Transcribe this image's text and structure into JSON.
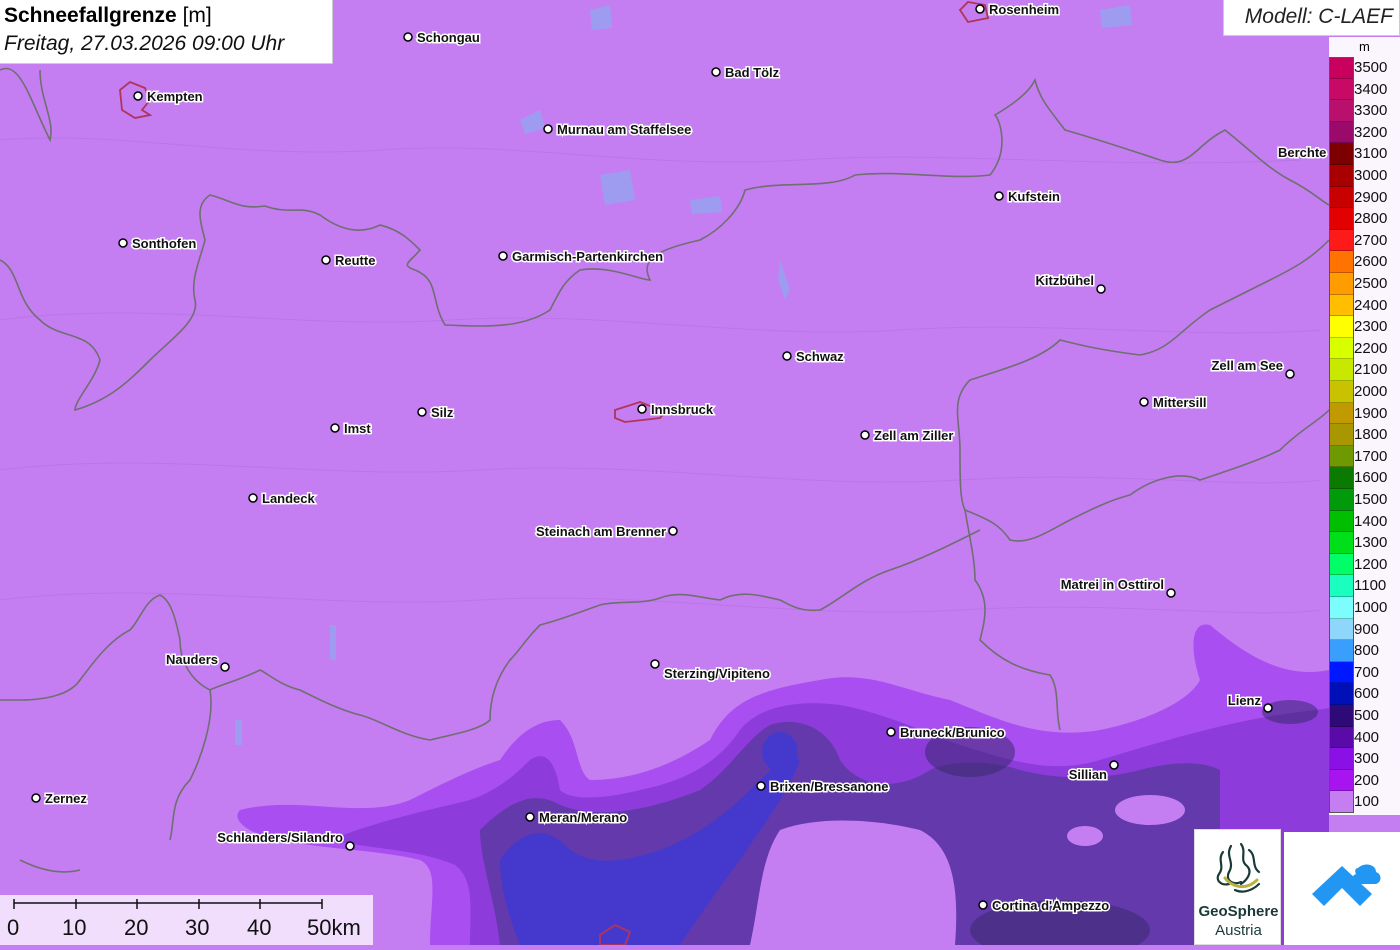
{
  "title": {
    "bold": "Schneefallgrenze",
    "unit": "[m]",
    "date": "Freitag, 27.03.2026 09:00 Uhr"
  },
  "model": "Modell: C-LAEF",
  "legend": {
    "unit": "m",
    "items": [
      {
        "label": "3500",
        "color": "#c8005e"
      },
      {
        "label": "3400",
        "color": "#c60a66"
      },
      {
        "label": "3300",
        "color": "#b8106c"
      },
      {
        "label": "3200",
        "color": "#9a0a6a"
      },
      {
        "label": "3100",
        "color": "#7d0000"
      },
      {
        "label": "3000",
        "color": "#a80000"
      },
      {
        "label": "2900",
        "color": "#c80000"
      },
      {
        "label": "2800",
        "color": "#e30000"
      },
      {
        "label": "2700",
        "color": "#ff1a1a"
      },
      {
        "label": "2600",
        "color": "#ff7400"
      },
      {
        "label": "2500",
        "color": "#ff9d00"
      },
      {
        "label": "2400",
        "color": "#ffbf00"
      },
      {
        "label": "2300",
        "color": "#ffff00"
      },
      {
        "label": "2200",
        "color": "#d7ff00"
      },
      {
        "label": "2100",
        "color": "#c9e800"
      },
      {
        "label": "2000",
        "color": "#c8c200"
      },
      {
        "label": "1900",
        "color": "#c09a00"
      },
      {
        "label": "1800",
        "color": "#a89700"
      },
      {
        "label": "1700",
        "color": "#6e9900"
      },
      {
        "label": "1600",
        "color": "#0b7a00"
      },
      {
        "label": "1500",
        "color": "#009a0a"
      },
      {
        "label": "1400",
        "color": "#00be00"
      },
      {
        "label": "1300",
        "color": "#00e01a"
      },
      {
        "label": "1200",
        "color": "#00ff66"
      },
      {
        "label": "1100",
        "color": "#1affc0"
      },
      {
        "label": "1000",
        "color": "#7dfdfd"
      },
      {
        "label": "900",
        "color": "#8fd6fb"
      },
      {
        "label": "800",
        "color": "#3a9efd"
      },
      {
        "label": "700",
        "color": "#0018ff"
      },
      {
        "label": "600",
        "color": "#0010b8"
      },
      {
        "label": "500",
        "color": "#2e0a78"
      },
      {
        "label": "400",
        "color": "#5a0aa8"
      },
      {
        "label": "300",
        "color": "#8a10e6"
      },
      {
        "label": "200",
        "color": "#a814f0"
      },
      {
        "label": "100",
        "color": "#c47ef2"
      }
    ]
  },
  "cities": {
    "rosenheim": "Rosenheim",
    "schongau": "Schongau",
    "kempten": "Kempten",
    "bad_toelz": "Bad Tölz",
    "murnau": "Murnau am Staffelsee",
    "berchtesgaden": "Berchte",
    "kufstein": "Kufstein",
    "sonthofen": "Sonthofen",
    "reutte": "Reutte",
    "garmisch": "Garmisch-Partenkirchen",
    "kitzbuehel": "Kitzbühel",
    "schwaz": "Schwaz",
    "zell_am_see": "Zell am See",
    "mittersill": "Mittersill",
    "innsbruck": "Innsbruck",
    "silz": "Silz",
    "imst": "Imst",
    "zell_am_ziller": "Zell am Ziller",
    "landeck": "Landeck",
    "steinach": "Steinach am Brenner",
    "matrei": "Matrei in Osttirol",
    "nauders": "Nauders",
    "sterzing": "Sterzing/Vipiteno",
    "lienz": "Lienz",
    "bruneck": "Bruneck/Brunico",
    "brixen": "Brixen/Bressanone",
    "sillian": "Sillian",
    "zernez": "Zernez",
    "meran": "Meran/Merano",
    "schlanders": "Schlanders/Silandro",
    "cortina": "Cortina d'Ampezzo"
  },
  "scale": {
    "labels": [
      "0",
      "10",
      "20",
      "30",
      "40",
      "50km"
    ]
  },
  "logos": {
    "geosphere_line1": "GeoSphere",
    "geosphere_line2": "Austria"
  }
}
